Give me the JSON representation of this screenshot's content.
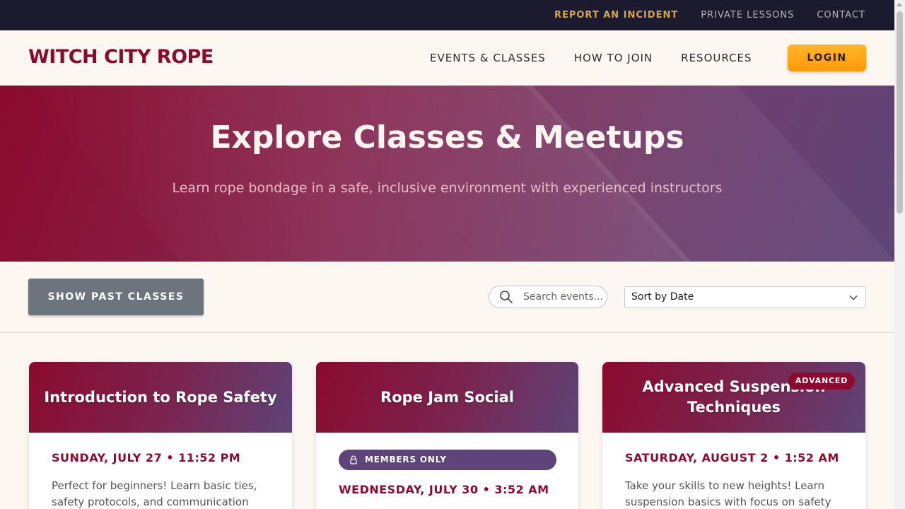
{
  "topbar": {
    "links": [
      {
        "label": "REPORT AN INCIDENT"
      },
      {
        "label": "PRIVATE LESSONS"
      },
      {
        "label": "CONTACT"
      }
    ]
  },
  "header": {
    "logo": "WITCH CITY ROPE",
    "nav": [
      {
        "label": "EVENTS & CLASSES"
      },
      {
        "label": "HOW TO JOIN"
      },
      {
        "label": "RESOURCES"
      }
    ],
    "login_label": "LOGIN"
  },
  "hero": {
    "title": "Explore Classes & Meetups",
    "subtitle": "Learn rope bondage in a safe, inclusive environment with experienced instructors"
  },
  "filters": {
    "show_past_label": "SHOW PAST CLASSES",
    "search_placeholder": "Search events...",
    "sort_value": "Sort by Date"
  },
  "cards": [
    {
      "title": "Introduction to Rope Safety",
      "date": "SUNDAY, JULY 27 • 11:52 PM",
      "description": "Perfect for beginners! Learn basic ties, safety protocols, and communication skills"
    },
    {
      "title": "Rope Jam Social",
      "tag": "MEMBERS ONLY",
      "date": "WEDNESDAY, JULY 30 • 3:52 AM"
    },
    {
      "title": "Advanced Suspension Techniques",
      "badge": "ADVANCED",
      "date": "SATURDAY, AUGUST 2 • 1:52 AM",
      "description": "Take your skills to new heights! Learn suspension basics with focus on safety"
    }
  ],
  "colors": {
    "brand": "#8b0a2e",
    "accent": "#ff9a06",
    "topbar": "#1c1a2e",
    "purple": "#5e4478"
  }
}
